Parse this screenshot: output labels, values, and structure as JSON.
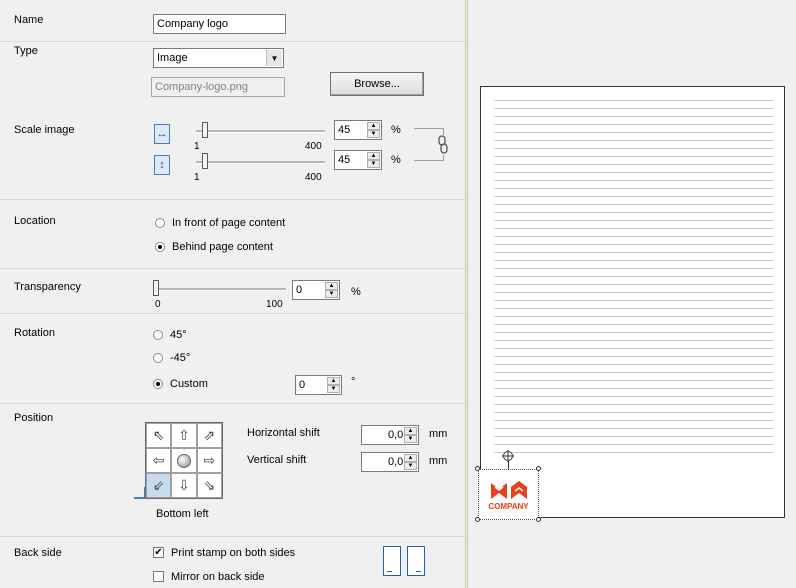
{
  "sections": {
    "name": "Name",
    "type": "Type",
    "scale_image": "Scale image",
    "location": "Location",
    "transparency": "Transparency",
    "rotation": "Rotation",
    "position": "Position",
    "back_side": "Back side"
  },
  "name_field": {
    "value": "Company logo"
  },
  "type_select": {
    "value": "Image",
    "options_visible": [
      "Image"
    ]
  },
  "file_field": {
    "value": "Company-logo.png"
  },
  "browse_button": "Browse...",
  "scale": {
    "horizontal": {
      "min": "1",
      "max": "400",
      "value": "45",
      "unit": "%",
      "level": 0.11
    },
    "vertical": {
      "min": "1",
      "max": "400",
      "value": "45",
      "unit": "%",
      "level": 0.11
    },
    "link_icon": "chain-link-icon"
  },
  "location": {
    "options": [
      "In front of page content",
      "Behind page content"
    ],
    "selected": "Behind page content"
  },
  "transparency": {
    "min": "0",
    "max": "100",
    "value": "0",
    "unit": "%",
    "level": 0.0
  },
  "rotation": {
    "options": [
      "45°",
      "-45°",
      "Custom"
    ],
    "selected": "Custom",
    "custom_value": "0",
    "unit": "°"
  },
  "position": {
    "grid_selected": "Bottom left",
    "caption": "Bottom left",
    "horizontal_shift_label": "Horizontal shift",
    "horizontal_shift_value": "0,0",
    "vertical_shift_label": "Vertical shift",
    "vertical_shift_value": "0,0",
    "unit": "mm"
  },
  "back_side": {
    "print_both_label": "Print stamp on both sides",
    "print_both_checked": true,
    "mirror_label": "Mirror on back side",
    "mirror_checked": false
  },
  "preview": {
    "stamp_text": "COMPANY",
    "stamp_color": "#e8401c"
  },
  "colors": {
    "panel_bg": "#f0f0f0",
    "selection": "#c9dcef",
    "accent": "#2b5ea8"
  }
}
